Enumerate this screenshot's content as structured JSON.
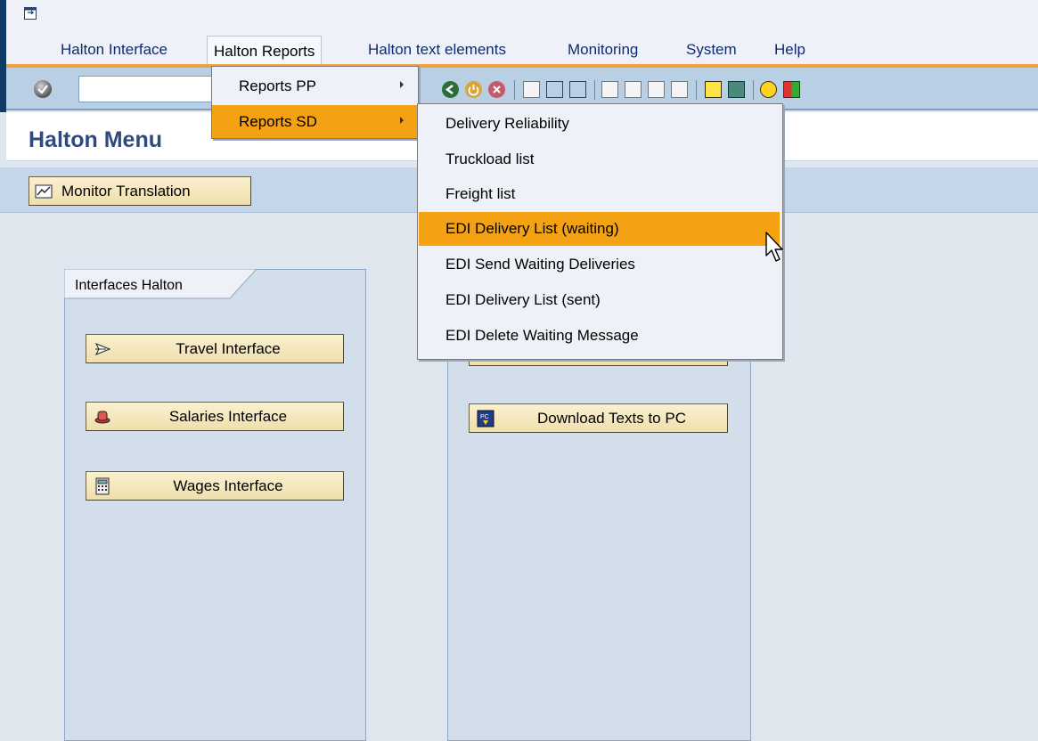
{
  "menubar": {
    "items": [
      "Halton Interface",
      "Halton Reports",
      "Halton text elements",
      "Monitoring",
      "System",
      "Help"
    ]
  },
  "toolbar": {
    "command_field_value": "",
    "icons": [
      "enter-check-icon",
      "back-icon",
      "exit-icon",
      "cancel-icon",
      "print-icon",
      "find-icon",
      "find-next-icon",
      "first-page-icon",
      "previous-page-icon",
      "next-page-icon",
      "last-page-icon",
      "create-session-icon",
      "shortcut-icon",
      "help-icon",
      "layout-icon"
    ]
  },
  "title": "Halton Menu",
  "app_toolbar": {
    "monitor_translation": "Monitor Translation"
  },
  "groups": {
    "interfaces": {
      "tab_label": "Interfaces Halton",
      "buttons": [
        "Travel Interface",
        "Salaries Interface",
        "Wages Interface"
      ]
    },
    "texts": {
      "buttons": [
        "Download Texts to PC"
      ]
    }
  },
  "reports_menu": {
    "items": [
      "Reports PP",
      "Reports SD"
    ],
    "highlighted": "Reports SD"
  },
  "reports_sd_submenu": {
    "items": [
      "Delivery Reliability",
      "Truckload list",
      "Freight list",
      "EDI Delivery List (waiting)",
      "EDI Send Waiting Deliveries",
      "EDI Delivery List (sent)",
      "EDI Delete Waiting Message"
    ],
    "highlighted": "EDI Delivery List (waiting)"
  },
  "colors": {
    "highlight": "#f4a214",
    "title": "#2e4a80",
    "menu_accent": "#f0a03c",
    "button_bg": "#f2e4b6"
  }
}
